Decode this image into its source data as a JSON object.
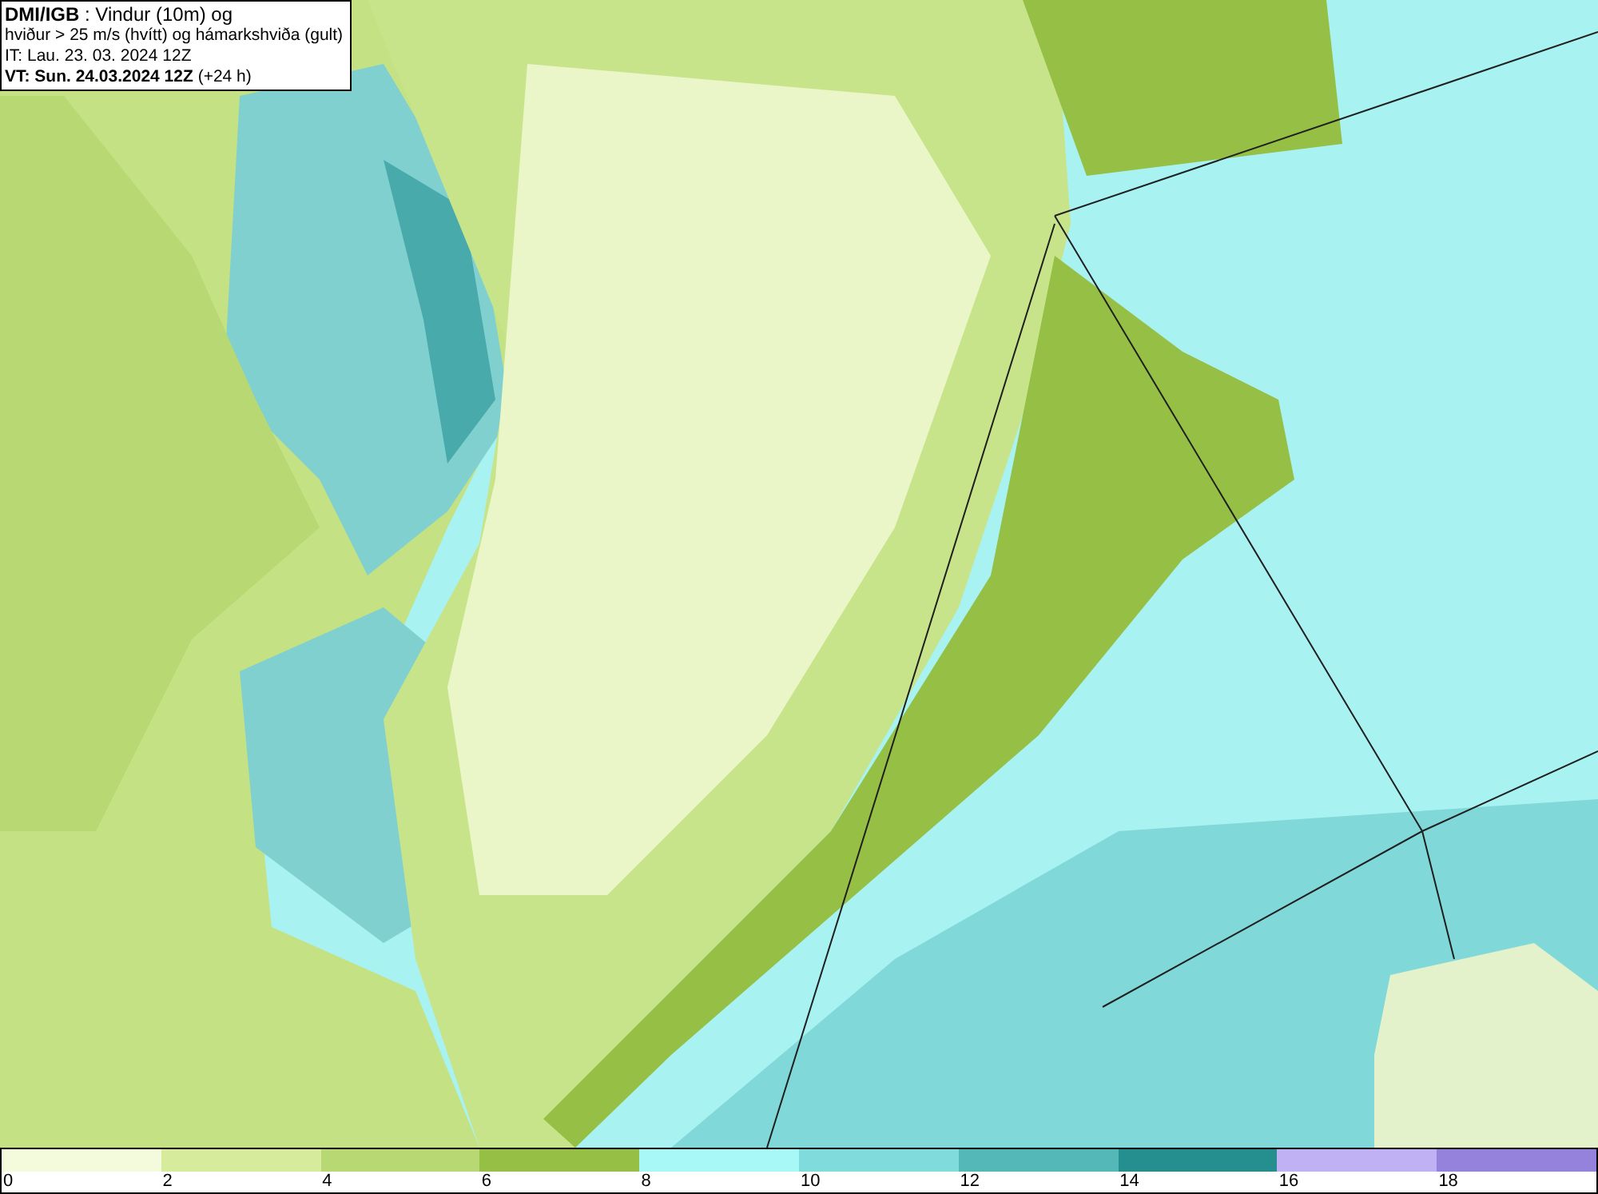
{
  "info_box": {
    "lines": [
      "**DMI/IGB** : Vindur (10m) og",
      "hviður > 25 m/s (hvítt) og hámarkshviða (gult)",
      "IT: Lau. 23. 03. 2024 12Z",
      "**VT: Sun. 24.03.2024 12Z** (+24 h)"
    ]
  },
  "legend": {
    "bins": [
      {
        "color": "#f4fadc",
        "label": "0"
      },
      {
        "color": "#d6eb9c",
        "label": "2"
      },
      {
        "color": "#b8d873",
        "label": "4"
      },
      {
        "color": "#96bf45",
        "label": "6"
      },
      {
        "color": "#a8f8f8",
        "label": "8"
      },
      {
        "color": "#80dcdc",
        "label": "10"
      },
      {
        "color": "#55b8b8",
        "label": "12"
      },
      {
        "color": "#258f8f",
        "label": "14"
      },
      {
        "color": "#c0b0f4",
        "label": "16"
      },
      {
        "color": "#9582dc",
        "label": "18"
      }
    ]
  }
}
